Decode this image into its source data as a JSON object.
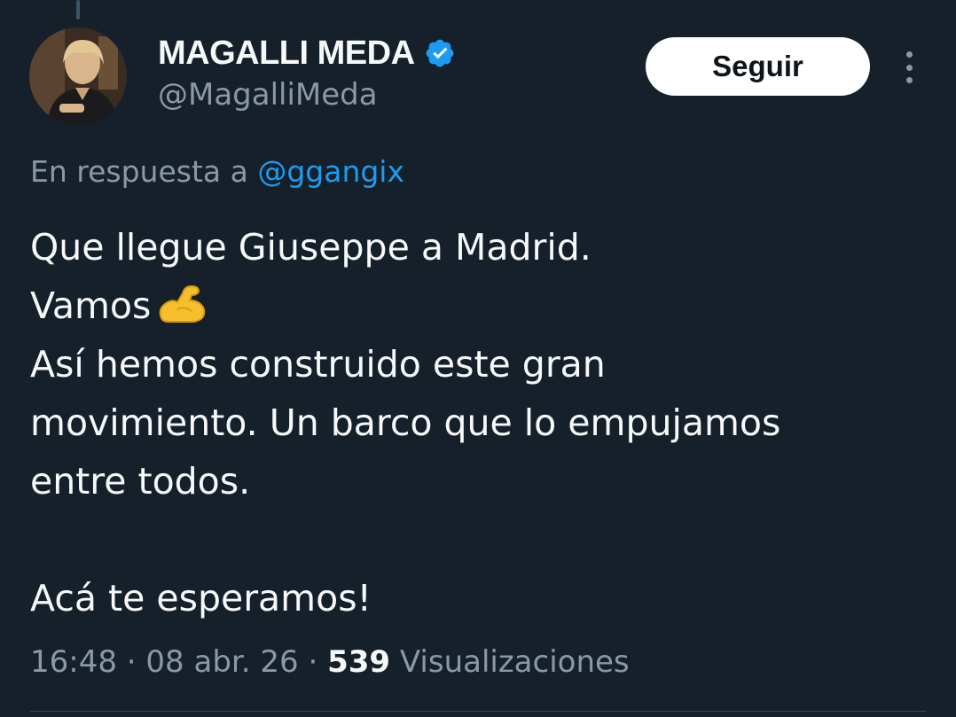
{
  "tweet": {
    "author": {
      "display_name": "MAGALLI MEDA",
      "handle": "@MagalliMeda",
      "verified": true,
      "verified_icon": "verified-badge-icon"
    },
    "follow_label": "Seguir",
    "more_icon": "more-options-icon",
    "reply_to": {
      "prefix": "En respuesta a",
      "mention": "@ggangix"
    },
    "text_lines": [
      "Que llegue Giuseppe a Madrid.",
      "Vamos",
      "Así hemos construido este gran",
      "movimiento. Un barco que lo empujamos",
      "entre todos.",
      "",
      "Acá te esperamos!"
    ],
    "emoji": "flexed-biceps-icon",
    "meta": {
      "time": "16:48",
      "separator": "·",
      "date": "08 abr. 26",
      "views_count": "539",
      "views_label": "Visualizaciones"
    }
  },
  "colors": {
    "background": "#15202b",
    "text_primary": "#f7f9f9",
    "text_secondary": "#8b98a5",
    "accent": "#1d9bf0",
    "button_bg": "#ffffff",
    "button_text": "#0f1419"
  }
}
